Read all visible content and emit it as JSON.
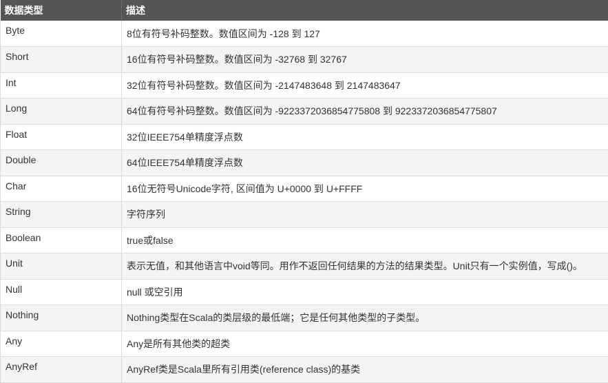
{
  "header": {
    "col1": "数据类型",
    "col2": "描述"
  },
  "rows": [
    {
      "type": "Byte",
      "desc": "8位有符号补码整数。数值区间为 -128 到 127"
    },
    {
      "type": "Short",
      "desc": "16位有符号补码整数。数值区间为 -32768 到 32767"
    },
    {
      "type": "Int",
      "desc": "32位有符号补码整数。数值区间为 -2147483648 到 2147483647"
    },
    {
      "type": "Long",
      "desc": "64位有符号补码整数。数值区间为 -9223372036854775808 到 9223372036854775807"
    },
    {
      "type": "Float",
      "desc": "32位IEEE754单精度浮点数"
    },
    {
      "type": "Double",
      "desc": "64位IEEE754单精度浮点数"
    },
    {
      "type": "Char",
      "desc": "16位无符号Unicode字符, 区间值为 U+0000 到 U+FFFF"
    },
    {
      "type": "String",
      "desc": "字符序列"
    },
    {
      "type": "Boolean",
      "desc": "true或false"
    },
    {
      "type": "Unit",
      "desc": "表示无值，和其他语言中void等同。用作不返回任何结果的方法的结果类型。Unit只有一个实例值，写成()。"
    },
    {
      "type": "Null",
      "desc": "null 或空引用"
    },
    {
      "type": "Nothing",
      "desc": "Nothing类型在Scala的类层级的最低端；它是任何其他类型的子类型。"
    },
    {
      "type": "Any",
      "desc": "Any是所有其他类的超类"
    },
    {
      "type": "AnyRef",
      "desc": "AnyRef类是Scala里所有引用类(reference class)的基类"
    }
  ]
}
